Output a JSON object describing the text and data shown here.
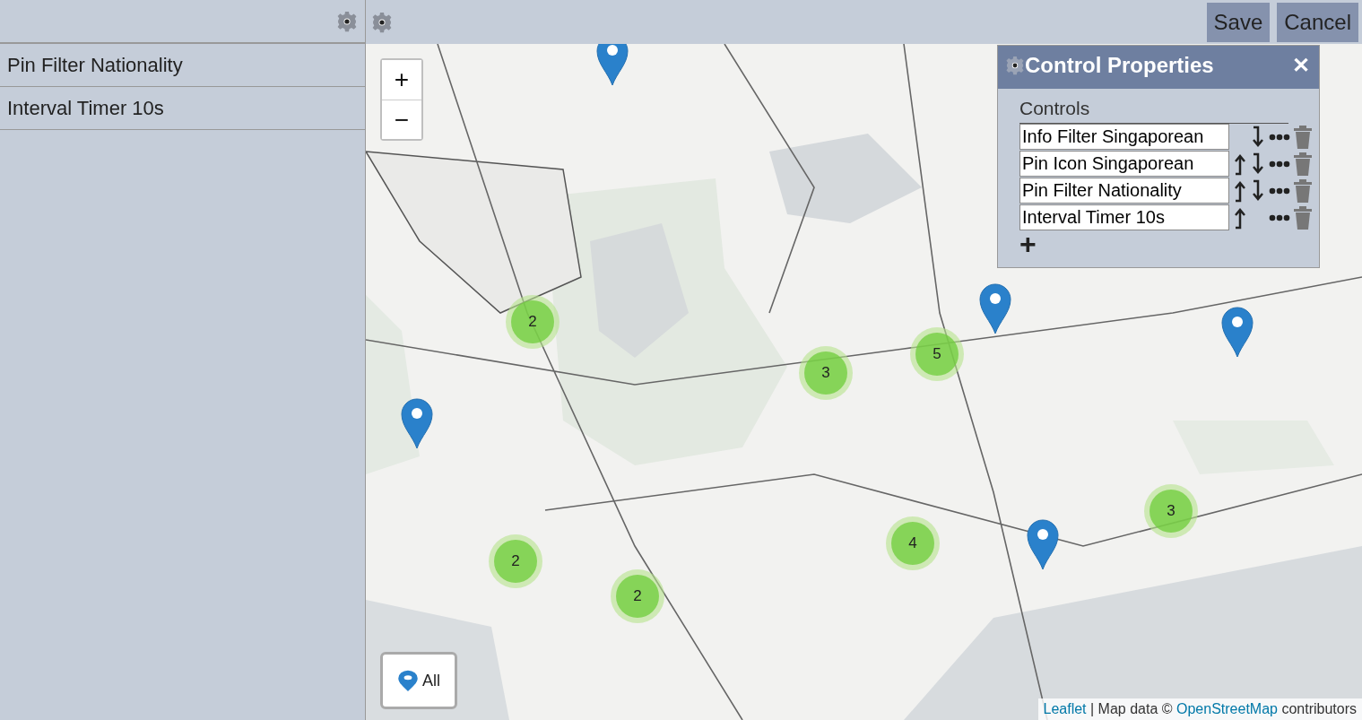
{
  "sidebar": {
    "items": [
      {
        "label": "Pin Filter Nationality"
      },
      {
        "label": "Interval Timer 10s"
      }
    ]
  },
  "toolbar": {
    "buttons": [
      "Save",
      "Cancel"
    ]
  },
  "map": {
    "zoom_buttons": [
      "+",
      "−"
    ],
    "markers": [
      {
        "kind": "pin"
      },
      {
        "kind": "cluster",
        "count": "2"
      },
      {
        "kind": "pin"
      },
      {
        "kind": "cluster",
        "count": "5"
      },
      {
        "kind": "pin"
      },
      {
        "kind": "cluster",
        "count": "3"
      },
      {
        "kind": "pin"
      },
      {
        "kind": "cluster",
        "count": "3"
      },
      {
        "kind": "cluster",
        "count": "4"
      },
      {
        "kind": "cluster",
        "count": "2"
      },
      {
        "kind": "pin"
      },
      {
        "kind": "cluster",
        "count": "2"
      }
    ],
    "filter_button": "All",
    "attribution": [
      {
        "kind": "link",
        "text": "Leaflet"
      },
      {
        "kind": "text",
        "text": " | Map data © "
      },
      {
        "kind": "link",
        "text": "OpenStreetMap"
      },
      {
        "kind": "text",
        "text": " contributors"
      }
    ]
  },
  "panel": {
    "title": "Control Properties",
    "close": "✕",
    "section": "Controls",
    "controls": [
      {
        "name": "Info Filter Singaporean",
        "move_up": false,
        "move_down": true
      },
      {
        "name": "Pin Icon Singaporean",
        "move_up": true,
        "move_down": true
      },
      {
        "name": "Pin Filter Nationality",
        "move_up": true,
        "move_down": true
      },
      {
        "name": "Interval Timer 10s",
        "move_up": true,
        "move_down": false
      }
    ],
    "add": "+"
  }
}
